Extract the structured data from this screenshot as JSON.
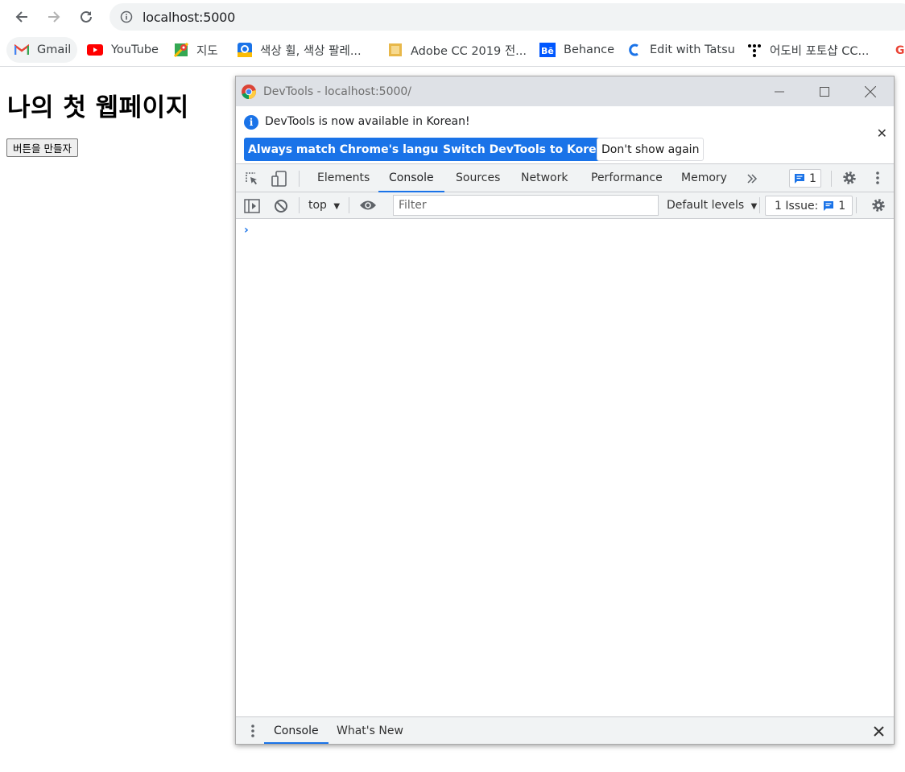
{
  "browser": {
    "url": "localhost:5000",
    "bookmarks": [
      {
        "label": "Gmail",
        "icon": "gmail-icon"
      },
      {
        "label": "YouTube",
        "icon": "youtube-icon"
      },
      {
        "label": "지도",
        "icon": "maps-icon"
      },
      {
        "label": "색상 휠, 색상 팔레...",
        "icon": "color-icon"
      },
      {
        "label": "Adobe CC 2019 전...",
        "icon": "adobe-icon"
      },
      {
        "label": "Behance",
        "icon": "behance-icon"
      },
      {
        "label": "Edit with Tatsu",
        "icon": "tatsu-icon"
      },
      {
        "label": "어도비 포토샵 CC...",
        "icon": "dots-icon"
      }
    ]
  },
  "page": {
    "heading": "나의 첫 웹페이지",
    "button_label": "버튼을 만들자"
  },
  "devtools": {
    "window_title": "DevTools - localhost:5000/",
    "infobar": {
      "message": "DevTools is now available in Korean!",
      "btn_match": "Always match Chrome's language",
      "btn_switch": "Switch DevTools to Korean",
      "btn_dismiss": "Don't show again"
    },
    "tabs": [
      "Elements",
      "Console",
      "Sources",
      "Network",
      "Performance",
      "Memory"
    ],
    "active_tab": "Console",
    "messages_badge": "1",
    "console": {
      "context": "top",
      "filter_placeholder": "Filter",
      "levels": "Default levels",
      "issues_label": "1 Issue:",
      "issues_count": "1"
    },
    "drawer_tabs": [
      "Console",
      "What's New"
    ]
  },
  "colors": {
    "accent": "#1a73e8",
    "toolbar_bg": "#f1f3f4",
    "titlebar_bg": "#dee1e6"
  }
}
